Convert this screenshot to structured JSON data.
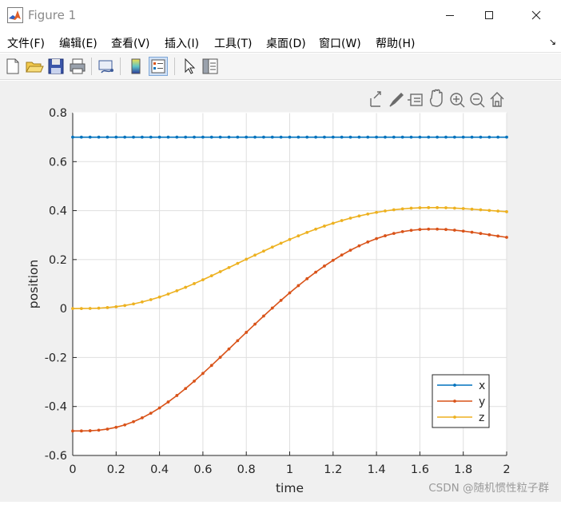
{
  "window": {
    "title": "Figure 1"
  },
  "menu": {
    "items": [
      {
        "label": "文件(F)"
      },
      {
        "label": "编辑(E)"
      },
      {
        "label": "查看(V)"
      },
      {
        "label": "插入(I)"
      },
      {
        "label": "工具(T)"
      },
      {
        "label": "桌面(D)"
      },
      {
        "label": "窗口(W)"
      },
      {
        "label": "帮助(H)"
      }
    ],
    "dock_arrow": "↘"
  },
  "toolbar": {
    "buttons": [
      "new-figure-icon",
      "open-file-icon",
      "save-icon",
      "print-icon",
      "link-plot-icon",
      "insert-colorbar-icon",
      "insert-legend-icon",
      "edit-plot-arrow-icon",
      "property-inspector-icon"
    ]
  },
  "axes_toolbar": {
    "buttons": [
      "export-icon",
      "brush-icon",
      "data-tips-icon",
      "pan-icon",
      "zoom-in-icon",
      "zoom-out-icon",
      "home-icon"
    ]
  },
  "watermark": "CSDN @随机惯性粒子群",
  "colors": {
    "x": "#0072bd",
    "y": "#d95319",
    "z": "#edb120"
  },
  "chart_data": {
    "type": "line",
    "xlabel": "time",
    "ylabel": "position",
    "xlim": [
      0,
      2
    ],
    "ylim": [
      -0.6,
      0.8
    ],
    "xticks": [
      "0",
      "0.2",
      "0.4",
      "0.6",
      "0.8",
      "1",
      "1.2",
      "1.4",
      "1.6",
      "1.8",
      "2"
    ],
    "yticks": [
      "-0.6",
      "-0.4",
      "-0.2",
      "0",
      "0.2",
      "0.4",
      "0.6",
      "0.8"
    ],
    "grid": true,
    "legend_position": "bottom-right",
    "marker": "point",
    "x": [
      0,
      0.04,
      0.08,
      0.12,
      0.16,
      0.2,
      0.24,
      0.28,
      0.32,
      0.36,
      0.4,
      0.44,
      0.48,
      0.52,
      0.56,
      0.6,
      0.64,
      0.68,
      0.72,
      0.76,
      0.8,
      0.84,
      0.88,
      0.92,
      0.96,
      1,
      1.04,
      1.08,
      1.12,
      1.16,
      1.2,
      1.24,
      1.28,
      1.32,
      1.36,
      1.4,
      1.44,
      1.48,
      1.52,
      1.56,
      1.6,
      1.64,
      1.68,
      1.72,
      1.76,
      1.8,
      1.84,
      1.88,
      1.92,
      1.96,
      2
    ],
    "series": [
      {
        "name": "x",
        "values": [
          0.7,
          0.7,
          0.7,
          0.7,
          0.7,
          0.7,
          0.7,
          0.7,
          0.7,
          0.7,
          0.7,
          0.7,
          0.7,
          0.7,
          0.7,
          0.7,
          0.7,
          0.7,
          0.7,
          0.7,
          0.7,
          0.7,
          0.7,
          0.7,
          0.7,
          0.7,
          0.7,
          0.7,
          0.7,
          0.7,
          0.7,
          0.7,
          0.7,
          0.7,
          0.7,
          0.7,
          0.7,
          0.7,
          0.7,
          0.7,
          0.7,
          0.7,
          0.7,
          0.7,
          0.7,
          0.7,
          0.7,
          0.7,
          0.7,
          0.7,
          0.7
        ]
      },
      {
        "name": "y",
        "values": [
          -0.5,
          -0.4999,
          -0.4991,
          -0.4968,
          -0.4922,
          -0.4851,
          -0.4752,
          -0.4622,
          -0.4463,
          -0.4275,
          -0.4059,
          -0.3816,
          -0.3551,
          -0.3266,
          -0.2964,
          -0.2649,
          -0.2323,
          -0.199,
          -0.1652,
          -0.1312,
          -0.0973,
          -0.0637,
          -0.0306,
          0.0019,
          0.0335,
          0.0641,
          0.0936,
          0.1218,
          0.1485,
          0.1736,
          0.197,
          0.2186,
          0.2383,
          0.2561,
          0.2719,
          0.2856,
          0.2972,
          0.3067,
          0.3141,
          0.3195,
          0.3229,
          0.3244,
          0.3244,
          0.3229,
          0.3201,
          0.3163,
          0.3117,
          0.3066,
          0.3013,
          0.296,
          0.2909
        ]
      },
      {
        "name": "z",
        "values": [
          0,
          0.0001,
          0.0005,
          0.0016,
          0.0039,
          0.0075,
          0.0124,
          0.0189,
          0.0269,
          0.0363,
          0.047,
          0.0592,
          0.0725,
          0.0867,
          0.1018,
          0.1176,
          0.1338,
          0.1505,
          0.1674,
          0.1844,
          0.2013,
          0.2181,
          0.2347,
          0.2509,
          0.2668,
          0.2821,
          0.2968,
          0.3109,
          0.3243,
          0.3368,
          0.3485,
          0.3593,
          0.3692,
          0.378,
          0.3859,
          0.3928,
          0.3986,
          0.4034,
          0.4071,
          0.4098,
          0.4115,
          0.4122,
          0.4122,
          0.4115,
          0.4101,
          0.4082,
          0.4059,
          0.4033,
          0.4007,
          0.398,
          0.3955
        ]
      }
    ]
  }
}
